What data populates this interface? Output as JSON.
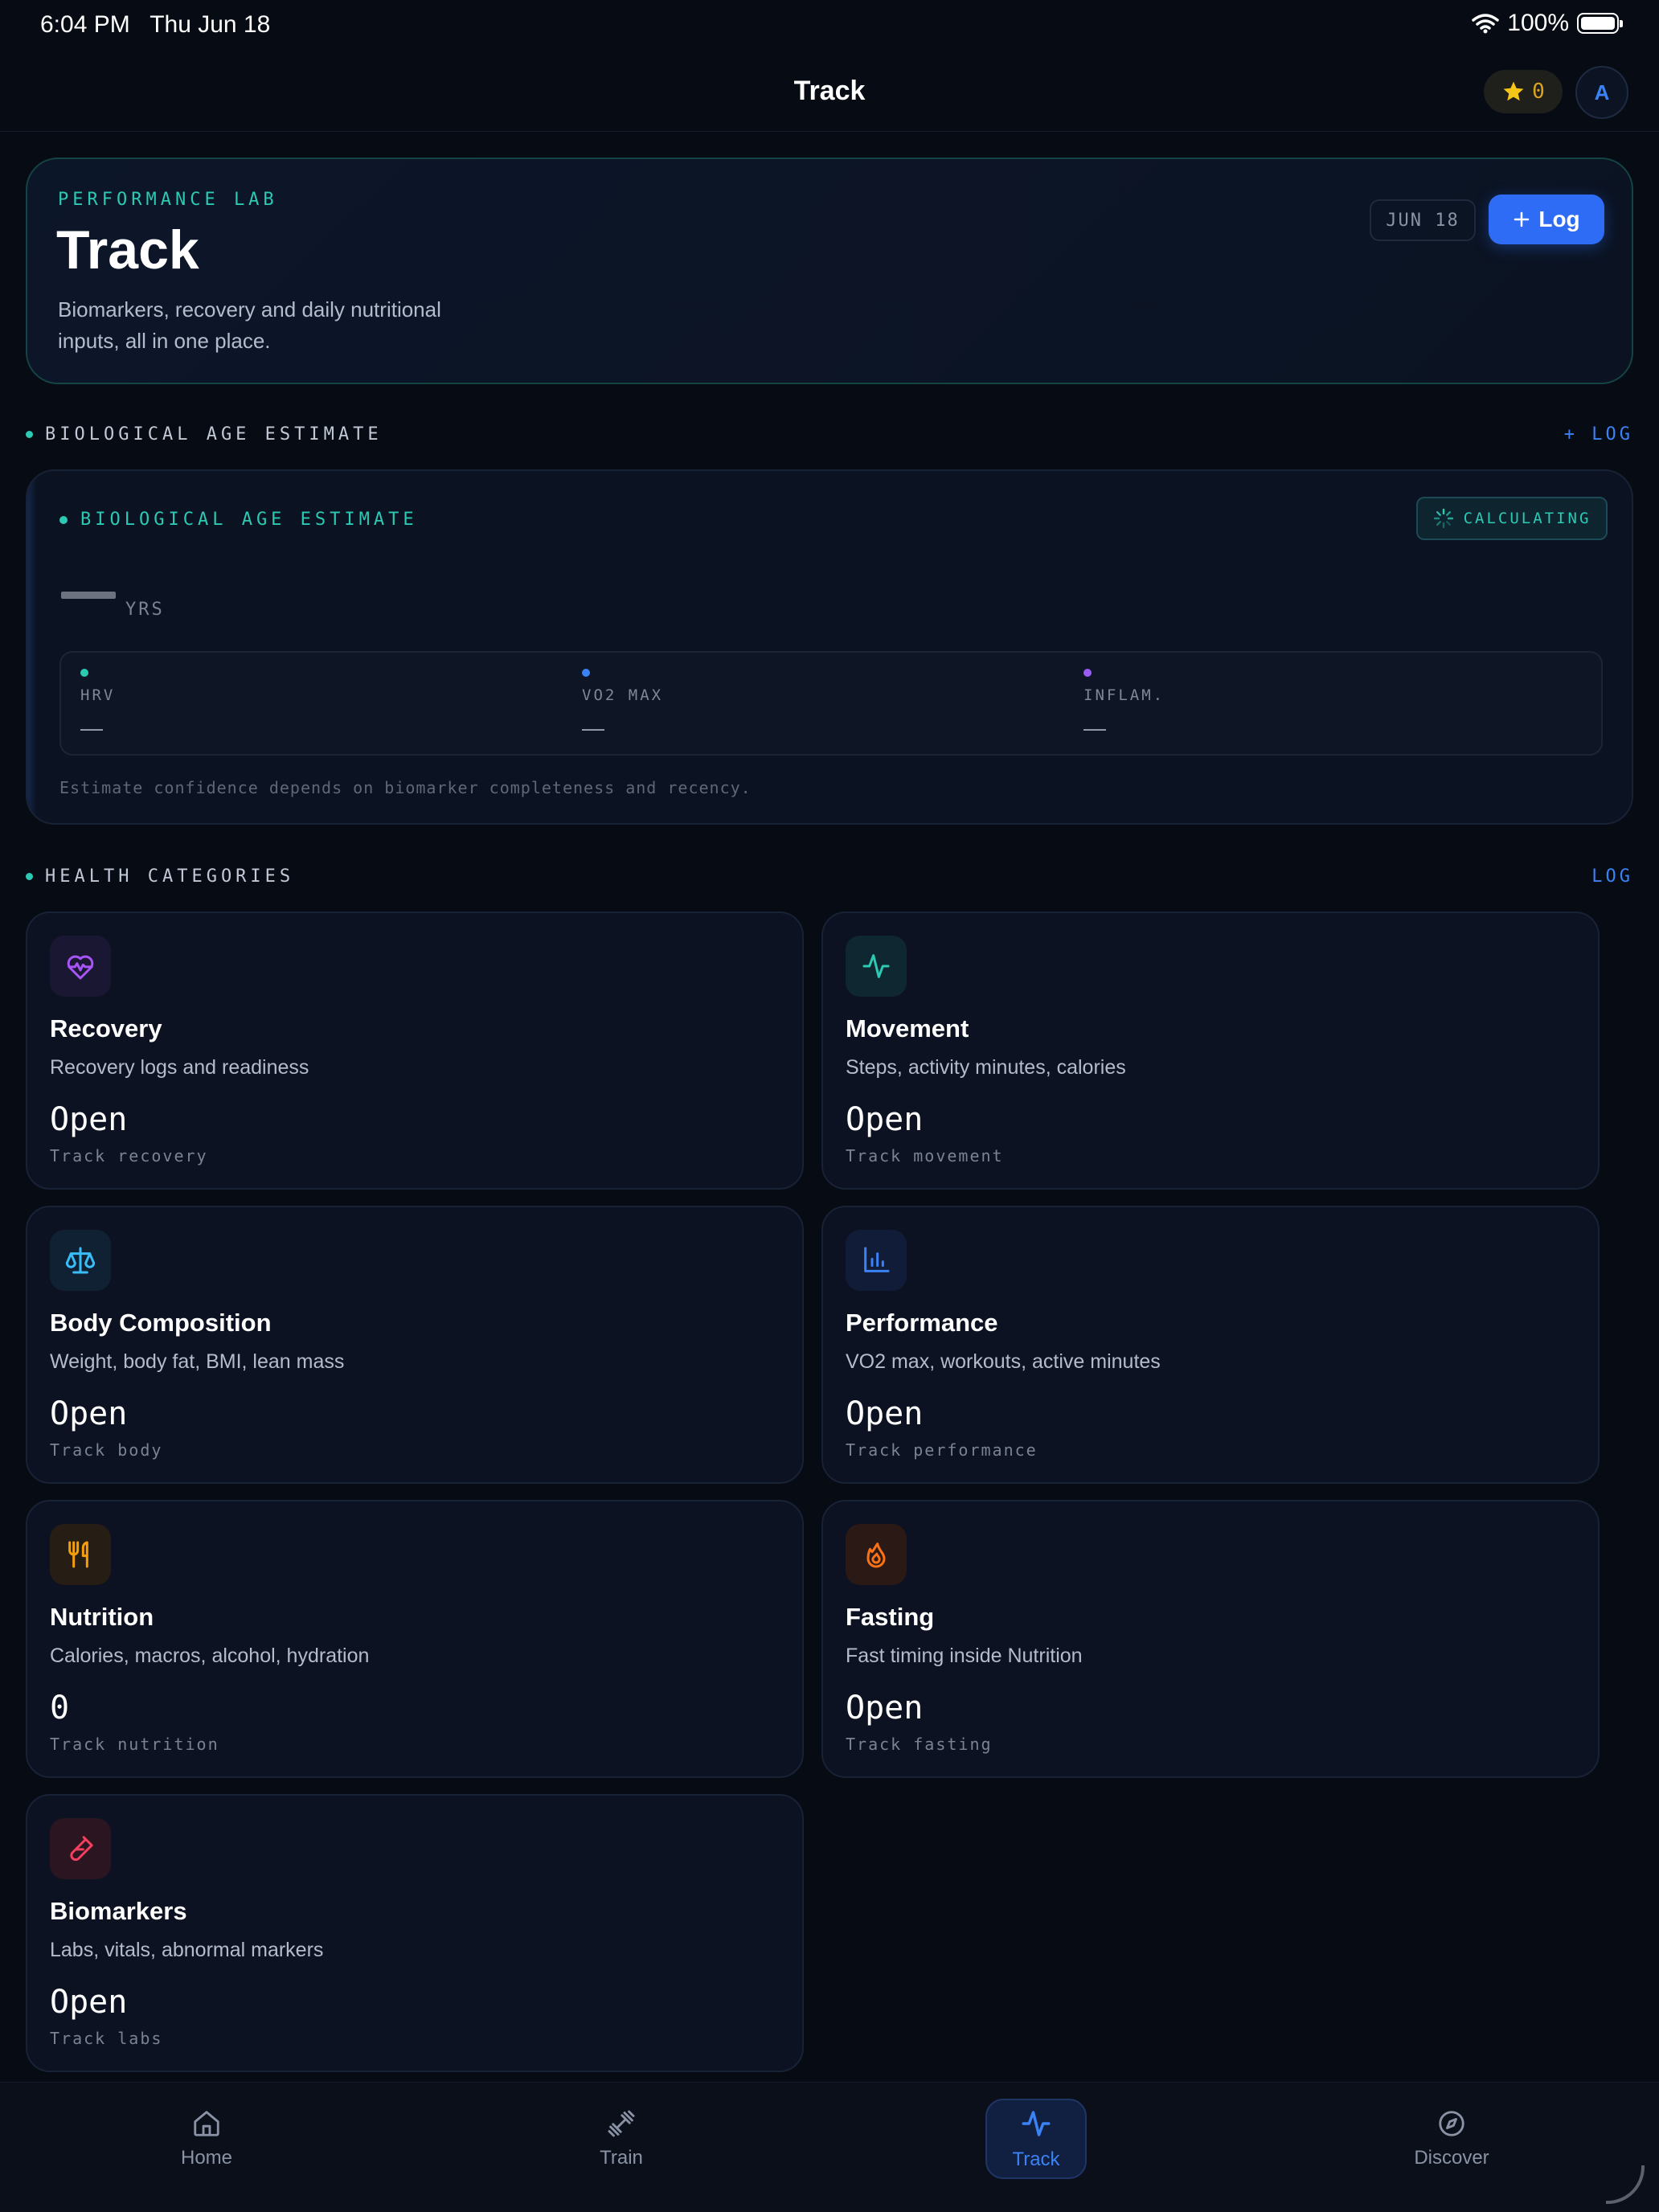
{
  "status_bar": {
    "time": "6:04 PM",
    "date": "Thu Jun 18",
    "battery": "100%"
  },
  "nav": {
    "title": "Track",
    "points": "0",
    "avatar_initial": "A"
  },
  "hero": {
    "eyebrow": "PERFORMANCE LAB",
    "title": "Track",
    "description": "Biomarkers, recovery and daily nutritional inputs, all in one place.",
    "date_chip": "JUN 18",
    "log_label": "Log"
  },
  "bio_section": {
    "label": "BIOLOGICAL AGE ESTIMATE",
    "action": "+ LOG"
  },
  "bio_card": {
    "label": "BIOLOGICAL AGE ESTIMATE",
    "status": "CALCULATING",
    "age_unit": "YRS",
    "metrics": [
      {
        "label": "HRV",
        "value": "—",
        "color": "#2cc9b3"
      },
      {
        "label": "VO2 MAX",
        "value": "—",
        "color": "#3b82f6"
      },
      {
        "label": "INFLAM.",
        "value": "—",
        "color": "#9b5cf6"
      }
    ],
    "footnote": "Estimate confidence depends on biomarker completeness and recency."
  },
  "categories_section": {
    "label": "HEALTH CATEGORIES",
    "action": "LOG"
  },
  "categories": [
    {
      "title": "Recovery",
      "desc": "Recovery logs and readiness",
      "value": "Open",
      "sub": "Track recovery",
      "icon": "heart-pulse-icon",
      "color": "#a855f7"
    },
    {
      "title": "Movement",
      "desc": "Steps, activity minutes, calories",
      "value": "Open",
      "sub": "Track movement",
      "icon": "activity-icon",
      "color": "#2cc9b3"
    },
    {
      "title": "Body Composition",
      "desc": "Weight, body fat, BMI, lean mass",
      "value": "Open",
      "sub": "Track body",
      "icon": "scale-icon",
      "color": "#38bdf8"
    },
    {
      "title": "Performance",
      "desc": "VO2 max, workouts, active minutes",
      "value": "Open",
      "sub": "Track performance",
      "icon": "bar-chart-icon",
      "color": "#3b82f6"
    },
    {
      "title": "Nutrition",
      "desc": "Calories, macros, alcohol, hydration",
      "value": "0",
      "sub": "Track nutrition",
      "icon": "utensils-icon",
      "color": "#f59e0b"
    },
    {
      "title": "Fasting",
      "desc": "Fast timing inside Nutrition",
      "value": "Open",
      "sub": "Track fasting",
      "icon": "flame-icon",
      "color": "#f97316"
    },
    {
      "title": "Biomarkers",
      "desc": "Labs, vitals, abnormal markers",
      "value": "Open",
      "sub": "Track labs",
      "icon": "test-tube-icon",
      "color": "#f43f5e"
    }
  ],
  "tabs": [
    {
      "label": "Home",
      "icon": "home-icon",
      "active": false
    },
    {
      "label": "Train",
      "icon": "dumbbell-icon",
      "active": false
    },
    {
      "label": "Track",
      "icon": "activity-icon",
      "active": true
    },
    {
      "label": "Discover",
      "icon": "compass-icon",
      "active": false
    }
  ]
}
